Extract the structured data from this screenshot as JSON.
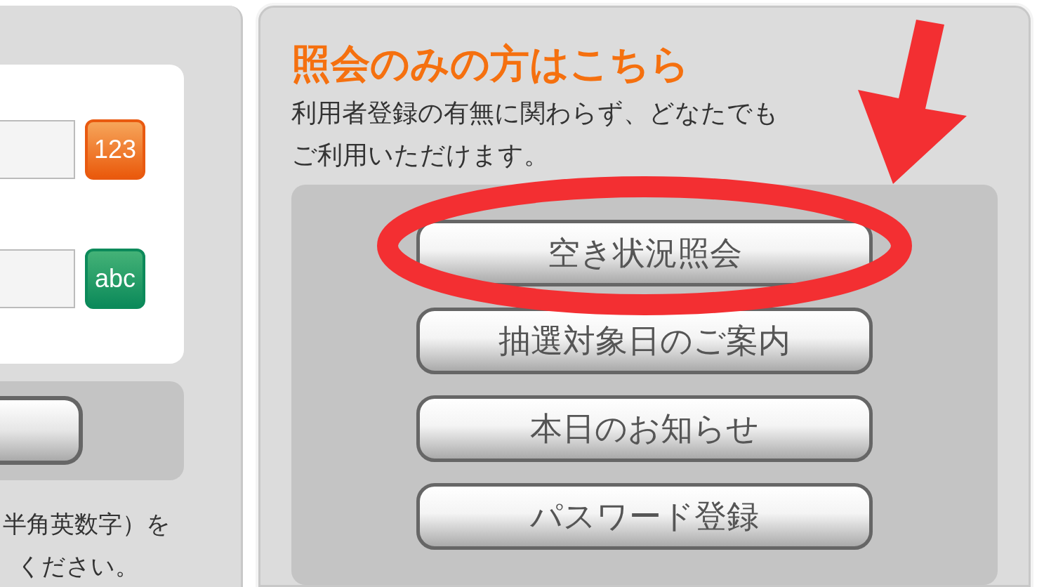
{
  "login_panel": {
    "fields": [
      {
        "kind": "number",
        "badge": "123"
      },
      {
        "kind": "alpha",
        "badge": "abc"
      }
    ],
    "note": [
      "半角英数字）を",
      "ください。"
    ]
  },
  "guest_panel": {
    "title": "照会のみの方はこちら",
    "description": [
      "利用者登録の有無に関わらず、どなたでも",
      "ご利用いただけます。"
    ],
    "buttons": [
      "空き状況照会",
      "抽選対象日のご案内",
      "本日のお知らせ",
      "パスワード登録"
    ]
  }
}
